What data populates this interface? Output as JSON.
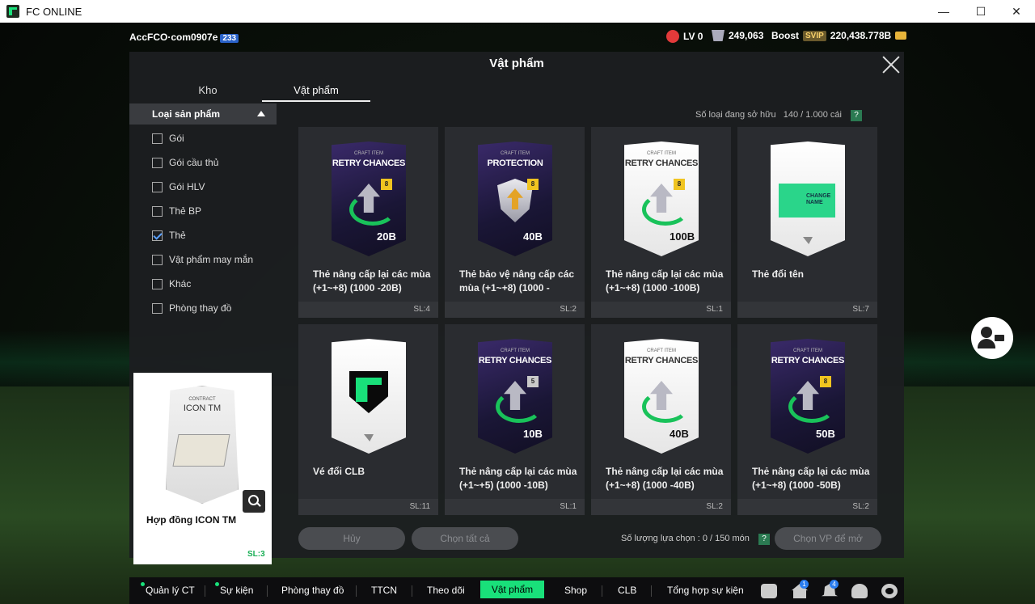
{
  "window": {
    "title": "FC ONLINE"
  },
  "topbar": {
    "account": "AccFCO·com0907e",
    "account_level": "233",
    "lv_label": "LV 0",
    "coins": "249,063",
    "boost_label": "Boost",
    "svip_label": "SVIP",
    "bp_amount": "220,438.778B"
  },
  "modal": {
    "title": "Vật phẩm",
    "tabs": [
      "Kho",
      "Vật phẩm"
    ],
    "owned_label": "Số loại đang sở hữu",
    "owned_value": "140 / 1.000 cái",
    "help": "?"
  },
  "sidebar": {
    "header": "Loại sản phẩm",
    "filters": [
      {
        "label": "Gói",
        "checked": false
      },
      {
        "label": "Gói cầu thủ",
        "checked": false
      },
      {
        "label": "Gói HLV",
        "checked": false
      },
      {
        "label": "Thẻ BP",
        "checked": false
      },
      {
        "label": "Thẻ",
        "checked": true
      },
      {
        "label": "Vật phẩm may mắn",
        "checked": false
      },
      {
        "label": "Khác",
        "checked": false
      },
      {
        "label": "Phòng thay đồ",
        "checked": false
      }
    ],
    "preview": {
      "card_tag": "CONTRACT",
      "card_title": "ICON TM",
      "name": "Hợp đồng ICON TM",
      "qty": "SL:3"
    }
  },
  "items": [
    {
      "type": "dark",
      "gfx": "arrow",
      "tag": "CRAFT ITEM",
      "title": "RETRY CHANCES",
      "badge": "8",
      "amount": "20B",
      "name": "Thẻ nâng cấp lại các mùa (+1~+8) (1000 -20B)",
      "qty": "SL:4"
    },
    {
      "type": "dark",
      "gfx": "shield",
      "tag": "CRAFT ITEM",
      "title": "PROTECTION",
      "badge": "8",
      "amount": "40B",
      "name": "Thẻ bảo vệ nâng cấp các mùa (+1~+8) (1000 -",
      "qty": "SL:2"
    },
    {
      "type": "light",
      "gfx": "arrow",
      "tag": "CRAFT ITEM",
      "title": "RETRY CHANCES",
      "badge": "8",
      "amount": "100B",
      "name": "Thẻ nâng cấp lại các mùa (+1~+8) (1000 -100B)",
      "qty": "SL:1"
    },
    {
      "type": "light",
      "gfx": "ticket",
      "tag": "",
      "title": "",
      "badge": "",
      "amount": "",
      "ticket_text": "CHANGE NAME",
      "name": "Thẻ đổi tên",
      "qty": "SL:7"
    },
    {
      "type": "light",
      "gfx": "logo",
      "tag": "",
      "title": "",
      "badge": "",
      "amount": "",
      "name": "Vé đổi CLB",
      "qty": "SL:11"
    },
    {
      "type": "dark",
      "gfx": "arrow",
      "tag": "CRAFT ITEM",
      "title": "RETRY CHANCES",
      "badge": "5",
      "badge_style": "silver",
      "amount": "10B",
      "name": "Thẻ nâng cấp lại các mùa (+1~+5) (1000 -10B)",
      "qty": "SL:1"
    },
    {
      "type": "light",
      "gfx": "arrow",
      "tag": "CRAFT ITEM",
      "title": "RETRY CHANCES",
      "badge": "",
      "amount": "40B",
      "name": "Thẻ nâng cấp lại các mùa (+1~+8) (1000 -40B)",
      "qty": "SL:2"
    },
    {
      "type": "dark",
      "gfx": "arrow",
      "tag": "CRAFT ITEM",
      "title": "RETRY CHANCES",
      "badge": "8",
      "amount": "50B",
      "name": "Thẻ nâng cấp lại các mùa (+1~+8) (1000 -50B)",
      "qty": "SL:2"
    }
  ],
  "actions": {
    "cancel": "Hủy",
    "select_all": "Chọn tất cả",
    "selected_label": "Số lượng lựa chọn : 0 / 150 món",
    "open": "Chọn VP để mở"
  },
  "bottomnav": {
    "items": [
      "Quản lý CT",
      "Sự kiện",
      "Phòng thay đồ",
      "TTCN",
      "Theo dõi",
      "Vật phẩm",
      "Shop",
      "CLB",
      "Tổng hợp sự kiện"
    ],
    "active": "Vật phẩm",
    "badges": {
      "home": "1",
      "bell": "4"
    },
    "icons": [
      "chat-icon",
      "home-icon",
      "bell-icon",
      "user-icon",
      "gear-icon"
    ]
  },
  "colors": {
    "accent": "#19e07a",
    "level_blue": "#2a62c9",
    "qty_green": "#1aaf56"
  }
}
